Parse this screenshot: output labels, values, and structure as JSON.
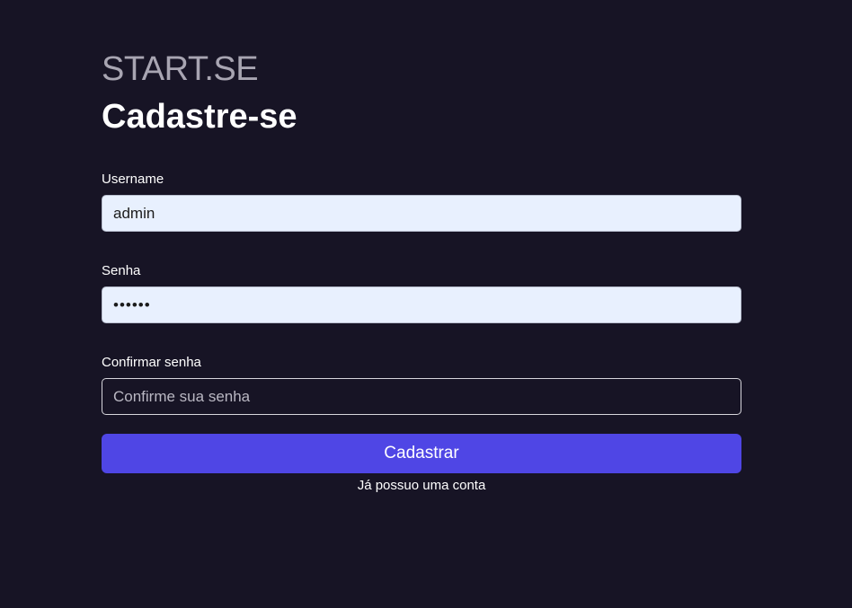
{
  "brand": "START.SE",
  "title": "Cadastre-se",
  "form": {
    "username": {
      "label": "Username",
      "value": "admin"
    },
    "password": {
      "label": "Senha",
      "value": "••••••"
    },
    "confirm_password": {
      "label": "Confirmar senha",
      "placeholder": "Confirme sua senha",
      "value": ""
    },
    "submit_label": "Cadastrar",
    "login_link": "Já possuo uma conta"
  },
  "colors": {
    "background": "#171425",
    "accent": "#4f46e5",
    "autofill_input": "#e8f0fe"
  }
}
